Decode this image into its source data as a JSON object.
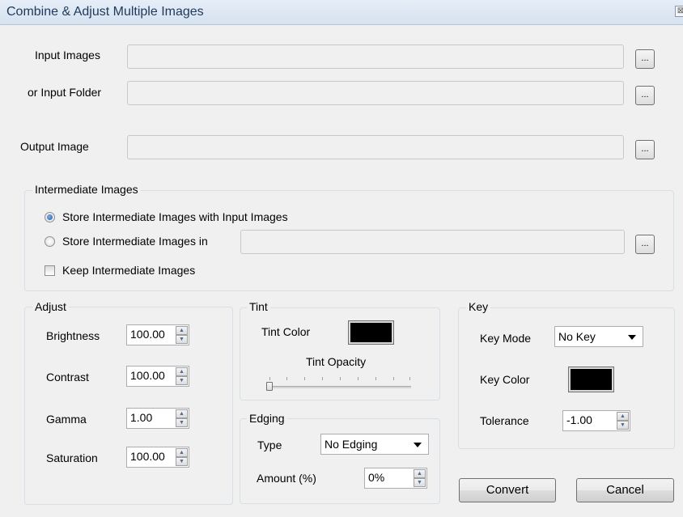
{
  "window": {
    "title": "Combine & Adjust Multiple Images",
    "close_glyph": "⊠"
  },
  "io": {
    "input_images_label": "Input Images",
    "input_images_value": "",
    "input_folder_label": "or Input Folder",
    "input_folder_value": "",
    "output_image_label": "Output Image",
    "output_image_value": "",
    "browse_label": "..."
  },
  "intermediate": {
    "legend": "Intermediate Images",
    "store_with_input_label": "Store Intermediate Images with Input Images",
    "store_in_label": "Store Intermediate Images in",
    "store_in_value": "",
    "keep_label": "Keep Intermediate Images",
    "selected_option": "store_with_input",
    "keep_checked": false
  },
  "adjust": {
    "legend": "Adjust",
    "brightness_label": "Brightness",
    "brightness_value": "100.00",
    "contrast_label": "Contrast",
    "contrast_value": "100.00",
    "gamma_label": "Gamma",
    "gamma_value": "1.00",
    "saturation_label": "Saturation",
    "saturation_value": "100.00"
  },
  "tint": {
    "legend": "Tint",
    "color_label": "Tint Color",
    "color": "#000000",
    "opacity_label": "Tint Opacity",
    "opacity_value": 0
  },
  "edging": {
    "legend": "Edging",
    "type_label": "Type",
    "type_value": "No Edging",
    "amount_label": "Amount (%)",
    "amount_value": "0%"
  },
  "key": {
    "legend": "Key",
    "mode_label": "Key Mode",
    "mode_value": "No Key",
    "color_label": "Key Color",
    "color": "#000000",
    "tolerance_label": "Tolerance",
    "tolerance_value": "-1.00"
  },
  "actions": {
    "convert_label": "Convert",
    "cancel_label": "Cancel"
  },
  "icons": {
    "spin_up": "spin-up-arrow",
    "spin_down": "spin-down-arrow",
    "dropdown": "chevron-down-icon"
  }
}
